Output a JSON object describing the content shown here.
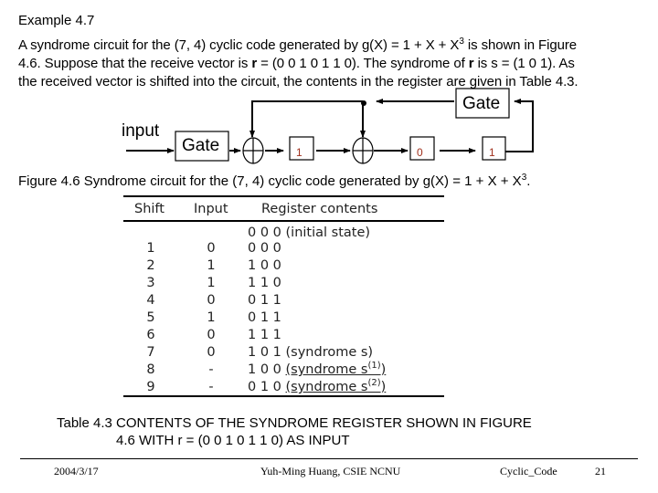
{
  "example_title": "Example 4.7",
  "paragraph": {
    "line1_pre": "A syndrome circuit for the (7, 4) cyclic code generated by g(X) = 1 + X + X",
    "line1_sup": "3",
    "line1_post": " is shown in Figure",
    "line2_pre": "4.6. Suppose that the receive vector is ",
    "line2_r": "r",
    "line2_mid": " = (0 0 1 0 1 1 0). The syndrome of ",
    "line2_r2": "r",
    "line2_post": " is s = (1 0 1). As",
    "line3": "the received vector is shifted into the circuit, the contents in the register are given in Table 4.3."
  },
  "circuit": {
    "input_label": "input",
    "gate_input_label": "Gate",
    "gate_feedback_label": "Gate",
    "registers": [
      "1",
      "0",
      "1"
    ],
    "register_text_color": "#a0301c"
  },
  "figure_caption": {
    "pre": "Figure 4.6 Syndrome circuit for the (7, 4) cyclic code generated by g(X) = 1 + X + X",
    "sup": "3",
    "post": "."
  },
  "table": {
    "headers": [
      "Shift",
      "Input",
      "Register contents"
    ],
    "initial_row": "0 0 0 (initial state)",
    "rows": [
      {
        "shift": "1",
        "input": "0",
        "reg": "0 0 0",
        "note": "",
        "sup": ""
      },
      {
        "shift": "2",
        "input": "1",
        "reg": "1 0 0",
        "note": "",
        "sup": ""
      },
      {
        "shift": "3",
        "input": "1",
        "reg": "1 1 0",
        "note": "",
        "sup": ""
      },
      {
        "shift": "4",
        "input": "0",
        "reg": "0 1 1",
        "note": "",
        "sup": ""
      },
      {
        "shift": "5",
        "input": "1",
        "reg": "0 1 1",
        "note": "",
        "sup": ""
      },
      {
        "shift": "6",
        "input": "0",
        "reg": "1 1 1",
        "note": "",
        "sup": ""
      },
      {
        "shift": "7",
        "input": "0",
        "reg": "1 0 1",
        "note": "(syndrome s)",
        "sup": ""
      },
      {
        "shift": "8",
        "input": "-",
        "reg": "1 0 0",
        "note": "(syndrome s",
        "sup": "(1)",
        "note_end": ")"
      },
      {
        "shift": "9",
        "input": "-",
        "reg": "0 1 0",
        "note": "(syndrome s",
        "sup": "(2)",
        "note_end": ")"
      }
    ]
  },
  "table_caption": {
    "line1": "Table 4.3 CONTENTS OF THE SYNDROME REGISTER SHOWN IN FIGURE",
    "line2": "4.6 WITH r = (0 0 1 0 1 1 0) AS INPUT"
  },
  "footer": {
    "date": "2004/3/17",
    "author": "Yuh-Ming Huang, CSIE NCNU",
    "topic": "Cyclic_Code",
    "page": "21"
  }
}
